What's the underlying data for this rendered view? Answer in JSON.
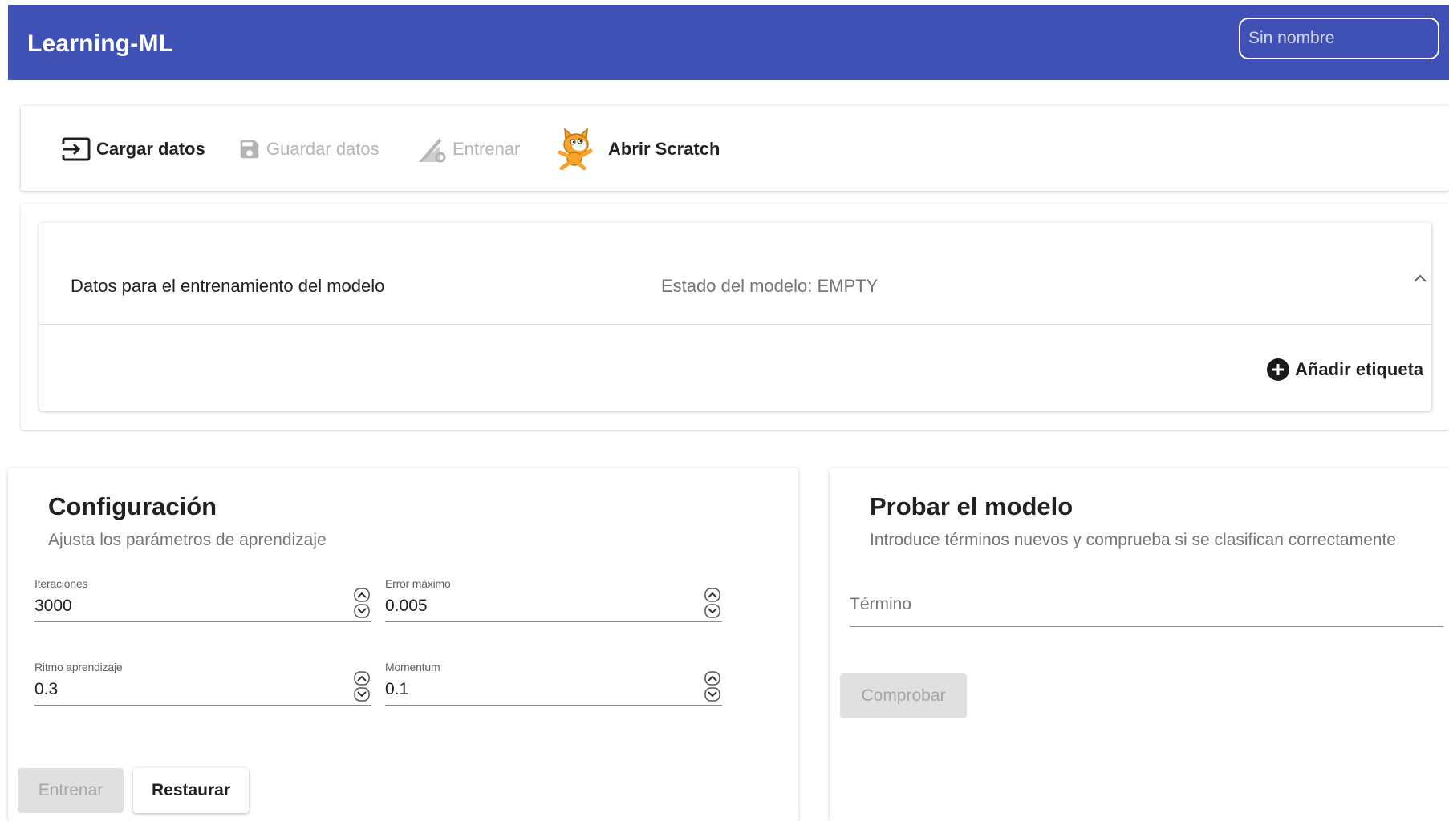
{
  "header": {
    "title": "Learning-ML",
    "name_placeholder": "Sin nombre"
  },
  "toolbar": {
    "load_label": "Cargar datos",
    "save_label": "Guardar datos",
    "train_label": "Entrenar",
    "scratch_label": "Abrir Scratch"
  },
  "data_panel": {
    "title": "Datos para el entrenamiento del modelo",
    "status": "Estado del modelo: EMPTY",
    "add_label": "Añadir etiqueta"
  },
  "config": {
    "title": "Configuración",
    "subtitle": "Ajusta los parámetros de aprendizaje",
    "fields": {
      "iterations": {
        "label": "Iteraciones",
        "value": "3000"
      },
      "max_error": {
        "label": "Error máximo",
        "value": "0.005"
      },
      "learning_rate": {
        "label": "Ritmo aprendizaje",
        "value": "0.3"
      },
      "momentum": {
        "label": "Momentum",
        "value": "0.1"
      }
    },
    "train_button": "Entrenar",
    "reset_button": "Restaurar"
  },
  "test": {
    "title": "Probar el modelo",
    "subtitle": "Introduce términos nuevos y comprueba si se clasifican correctamente",
    "term_placeholder": "Término",
    "check_button": "Comprobar"
  },
  "colors": {
    "primary": "#3f51b5",
    "disabled_text": "#a6a6a6",
    "disabled_bg": "#e0e0e0"
  },
  "icons": {
    "load": "input-icon",
    "save": "save-icon",
    "train": "train-settings-icon",
    "scratch": "scratch-cat-icon",
    "add": "add-circle-icon",
    "collapse": "chevron-up-icon"
  }
}
